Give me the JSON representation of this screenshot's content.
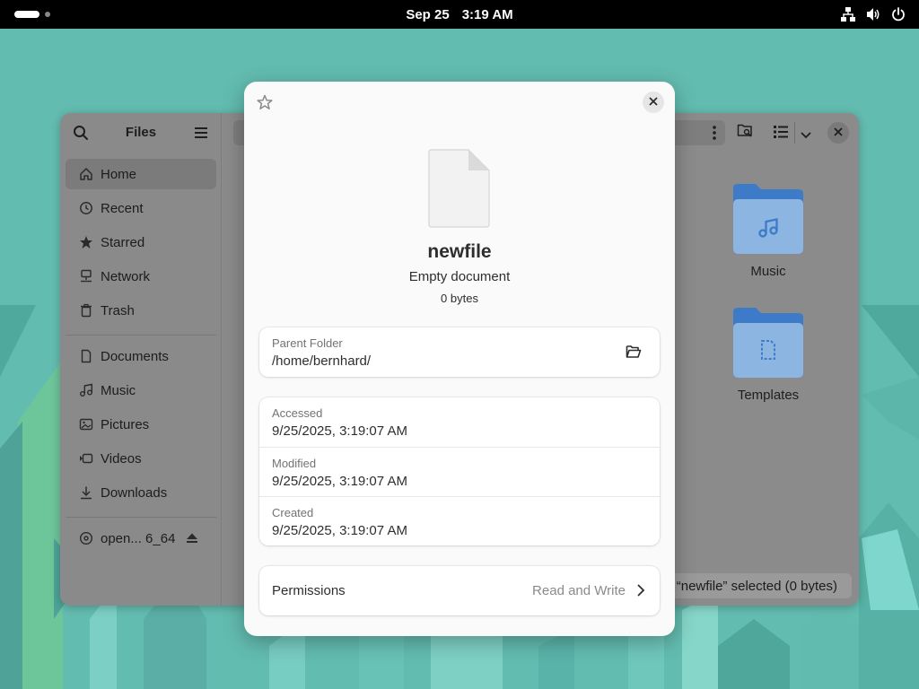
{
  "topbar": {
    "date": "Sep 25",
    "time": "3:19 AM",
    "tray_icons": [
      "network-icon",
      "volume-icon",
      "power-icon"
    ]
  },
  "files_window": {
    "title": "Files",
    "sidebar": {
      "places": [
        {
          "label": "Home",
          "icon": "home-icon",
          "active": true
        },
        {
          "label": "Recent",
          "icon": "clock-icon"
        },
        {
          "label": "Starred",
          "icon": "star-icon"
        },
        {
          "label": "Network",
          "icon": "network-icon"
        },
        {
          "label": "Trash",
          "icon": "trash-icon"
        }
      ],
      "bookmarks": [
        {
          "label": "Documents",
          "icon": "document-icon"
        },
        {
          "label": "Music",
          "icon": "music-icon"
        },
        {
          "label": "Pictures",
          "icon": "picture-icon"
        },
        {
          "label": "Videos",
          "icon": "video-icon"
        },
        {
          "label": "Downloads",
          "icon": "download-icon"
        }
      ],
      "devices": [
        {
          "label": "open... 6_64",
          "icon": "disc-icon"
        }
      ]
    },
    "folders": [
      {
        "label": "Music",
        "icon": "music-folder-icon"
      },
      {
        "label": "Templates",
        "icon": "templates-folder-icon"
      }
    ],
    "status": "“newfile” selected  (0 bytes)"
  },
  "properties_dialog": {
    "file_name": "newfile",
    "file_type": "Empty document",
    "file_size": "0 bytes",
    "parent_folder": {
      "label": "Parent Folder",
      "value": "/home/bernhard/"
    },
    "times": [
      {
        "label": "Accessed",
        "value": "9/25/2025, 3:19:07 AM"
      },
      {
        "label": "Modified",
        "value": "9/25/2025, 3:19:07 AM"
      },
      {
        "label": "Created",
        "value": "9/25/2025, 3:19:07 AM"
      }
    ],
    "permissions": {
      "label": "Permissions",
      "value": "Read and Write"
    }
  },
  "colors": {
    "wallpaper": "#5fb8ad",
    "folder_blue": "#3d7bc9",
    "folder_light": "#9ec1ea"
  }
}
